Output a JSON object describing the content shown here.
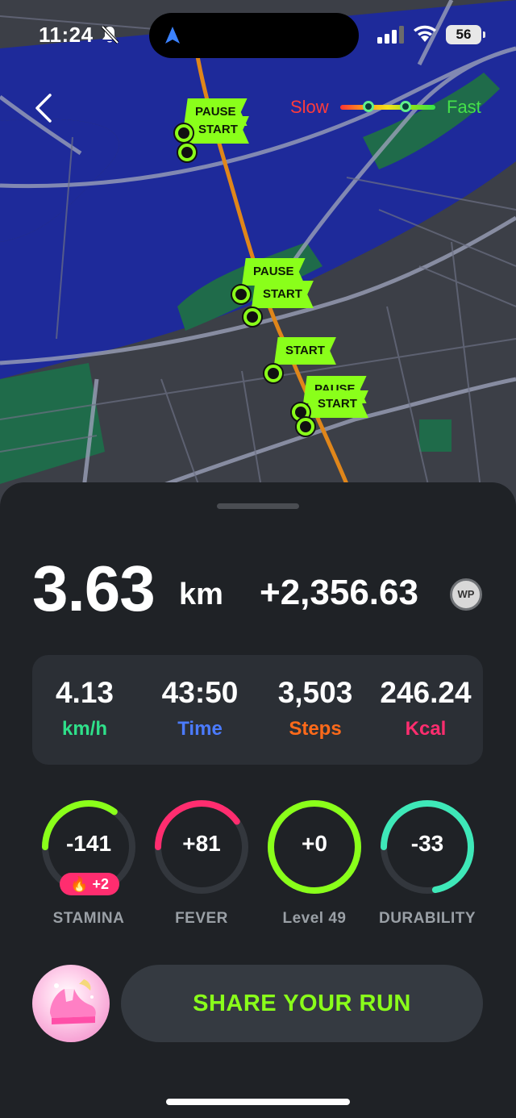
{
  "status_bar": {
    "time": "11:24",
    "battery": "56"
  },
  "map": {
    "speed_legend": {
      "slow_label": "Slow",
      "fast_label": "Fast"
    },
    "flags": [
      {
        "label": "PAUSE"
      },
      {
        "label": "START"
      },
      {
        "label": "PAUSE"
      },
      {
        "label": "START"
      },
      {
        "label": "START"
      },
      {
        "label": "PAUSE"
      },
      {
        "label": "START"
      }
    ]
  },
  "summary": {
    "distance_value": "3.63",
    "distance_unit": "km",
    "wp_earned": "+2,356.63",
    "wp_badge": "WP"
  },
  "stats": [
    {
      "value": "4.13",
      "label": "km/h",
      "color": "#2fe08a"
    },
    {
      "value": "43:50",
      "label": "Time",
      "color": "#4b7bff"
    },
    {
      "value": "3,503",
      "label": "Steps",
      "color": "#ff6a1a"
    },
    {
      "value": "246.24",
      "label": "Kcal",
      "color": "#ff2d6f"
    }
  ],
  "gauges": [
    {
      "value": "-141",
      "label": "STAMINA",
      "color": "#8aff1a",
      "fill_fraction": 0.35
    },
    {
      "value": "+81",
      "label": "FEVER",
      "color": "#ff2d6f",
      "fill_fraction": 0.4
    },
    {
      "value": "+0",
      "label": "Level 49",
      "color": "#8aff1a",
      "fill_fraction": 1.0
    },
    {
      "value": "-33",
      "label": "DURABILITY",
      "color": "#3ee8b8",
      "fill_fraction": 0.72
    }
  ],
  "stamina_bonus": "+2",
  "share_button": "SHARE YOUR RUN"
}
